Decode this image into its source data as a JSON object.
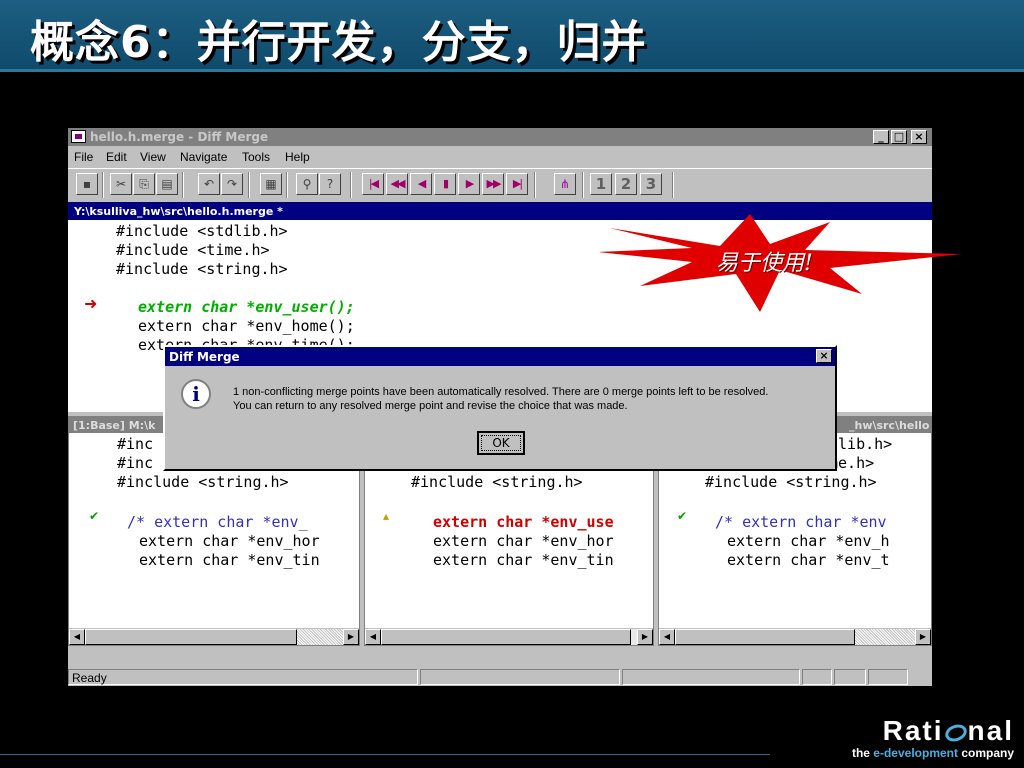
{
  "slide": {
    "title": "概念6：并行开发，分支，归并"
  },
  "window": {
    "title": "hello.h.merge - Diff Merge",
    "menu": [
      "File",
      "Edit",
      "View",
      "Navigate",
      "Tools",
      "Help"
    ],
    "path": "Y:\\ksulliva_hw\\src\\hello.h.merge *",
    "toolbar_numbers": [
      "1",
      "2",
      "3"
    ]
  },
  "editor": {
    "lines": [
      "#include <stdlib.h>",
      "#include <time.h>",
      "#include <string.h>",
      "",
      "extern char *env_user();",
      "extern char *env_home();",
      "extern char *env_time();"
    ]
  },
  "callout": {
    "text": "易于使用!"
  },
  "dialog": {
    "title": "Diff Merge",
    "message1": "1 non-conflicting merge points have been automatically resolved.  There are 0 merge points left to be resolved.",
    "message2": "You can return to any resolved merge point and revise the choice that was made.",
    "ok": "OK"
  },
  "panes": {
    "left": {
      "header": "[1:Base] M:\\k",
      "lines": [
        "#inc",
        "#inc",
        "#include <string.h>",
        "/* extern char *env_",
        "extern char *env_hor",
        "extern char *env_tin"
      ]
    },
    "middle": {
      "lines": [
        "#include <string.h>",
        "extern char *env_use",
        "extern char *env_hor",
        "extern char *env_tin"
      ]
    },
    "right": {
      "header": "_hw\\src\\hello",
      "lines": [
        "dlib.h>",
        "me.h>",
        "#include <string.h>",
        "/* extern char *env",
        "extern char *env_h",
        "extern char *env_t"
      ]
    }
  },
  "status": {
    "text": "Ready"
  },
  "logo": {
    "name": "Rational",
    "tagline_prefix": "the ",
    "tagline_highlight": "e-development",
    "tagline_suffix": " company"
  },
  "colors": {
    "title_bg": "#1d5f82",
    "accent": "#000080",
    "green": "#00b000",
    "red": "#d00000",
    "starburst": "#e00000"
  }
}
